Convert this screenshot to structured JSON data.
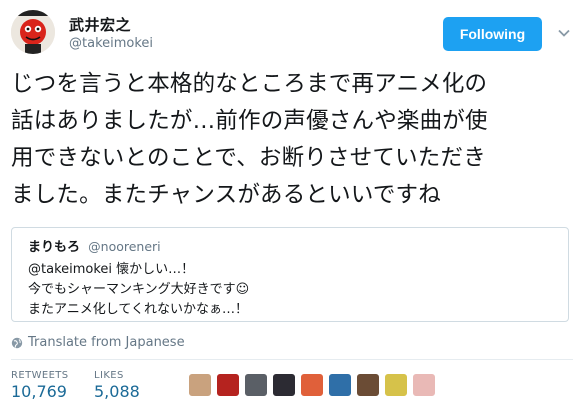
{
  "user": {
    "name": "武井宏之",
    "handle": "@takeimokei",
    "follow_label": "Following"
  },
  "tweet": {
    "lines": [
      "じつを言うと本格的なところまで再アニメ化の",
      "話はありましたが…前作の声優さんや楽曲が使",
      "用できないとのことで、お断りさせていただき",
      "ました。またチャンスがあるといいですね"
    ]
  },
  "quote": {
    "name": "まりもろ",
    "handle": "@nooreneri",
    "lines": [
      "@takeimokei 懐かしい…！",
      "今でもシャーマンキング大好きです☺",
      "またアニメ化してくれないかなぁ…！"
    ]
  },
  "translate_label": "Translate from Japanese",
  "stats": {
    "retweets_label": "RETWEETS",
    "retweets": "10,769",
    "likes_label": "LIKES",
    "likes": "5,088"
  },
  "likers": [
    {
      "color": "#c9a27e"
    },
    {
      "color": "#b5231f"
    },
    {
      "color": "#5a5f66"
    },
    {
      "color": "#2c2b33"
    },
    {
      "color": "#e0603a"
    },
    {
      "color": "#2f6fa8"
    },
    {
      "color": "#6b4c35"
    },
    {
      "color": "#d6c24a"
    },
    {
      "color": "#e9b9b6"
    }
  ],
  "colors": {
    "accent": "#1da1f2",
    "stat_value": "#1b6a97",
    "muted": "#657786"
  }
}
